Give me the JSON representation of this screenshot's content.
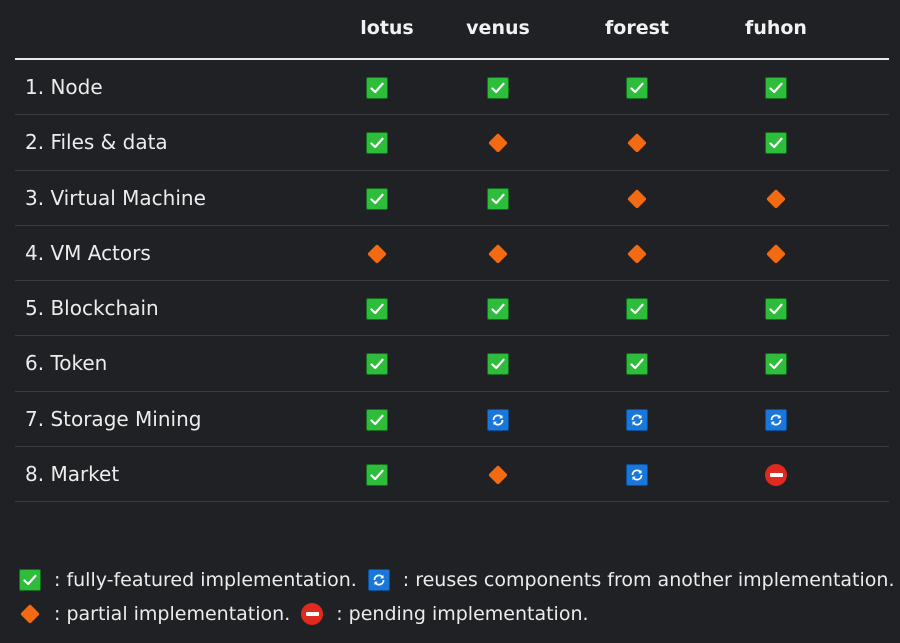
{
  "columns": [
    "lotus",
    "venus",
    "forest",
    "fuhon"
  ],
  "rows": [
    {
      "label": "1. Node",
      "cells": [
        "check-icon",
        "check-icon",
        "check-icon",
        "check-icon"
      ]
    },
    {
      "label": "2. Files & data",
      "cells": [
        "check-icon",
        "diamond-icon",
        "diamond-icon",
        "check-icon"
      ]
    },
    {
      "label": "3. Virtual Machine",
      "cells": [
        "check-icon",
        "check-icon",
        "diamond-icon",
        "diamond-icon"
      ]
    },
    {
      "label": "4. VM Actors",
      "cells": [
        "diamond-icon",
        "diamond-icon",
        "diamond-icon",
        "diamond-icon"
      ]
    },
    {
      "label": "5. Blockchain",
      "cells": [
        "check-icon",
        "check-icon",
        "check-icon",
        "check-icon"
      ]
    },
    {
      "label": "6. Token",
      "cells": [
        "check-icon",
        "check-icon",
        "check-icon",
        "check-icon"
      ]
    },
    {
      "label": "7. Storage Mining",
      "cells": [
        "check-icon",
        "reuse-icon",
        "reuse-icon",
        "reuse-icon"
      ]
    },
    {
      "label": "8. Market",
      "cells": [
        "check-icon",
        "diamond-icon",
        "reuse-icon",
        "pending-icon"
      ]
    }
  ],
  "legend": {
    "check": ": fully-featured implementation.",
    "reuse": ": reuses components from another implementation.",
    "diamond": ": partial implementation.",
    "pending": ": pending implementation."
  },
  "colors": {
    "check": "#2dbd3a",
    "diamond": "#f26a12",
    "reuse": "#1877d8",
    "pending": "#e02a20",
    "background": "#202124"
  }
}
